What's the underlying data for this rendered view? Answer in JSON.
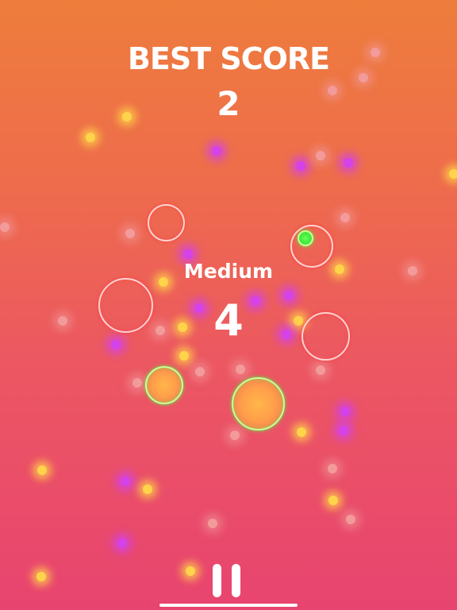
{
  "scoreboard": {
    "best_score_label": "BEST SCORE",
    "best_score_value": "2",
    "difficulty": "Medium",
    "current_score": "4"
  },
  "controls": {
    "pause_icon": "pause-icon"
  },
  "colors": {
    "background_top": "#ee7d3c",
    "background_bottom": "#e84470",
    "ring_red": "#ff3c3c",
    "ring_green": "#4dff3a",
    "glow_yellow": "#ffd34a",
    "glow_magenta": "#d442e8",
    "text": "#ffffff"
  }
}
